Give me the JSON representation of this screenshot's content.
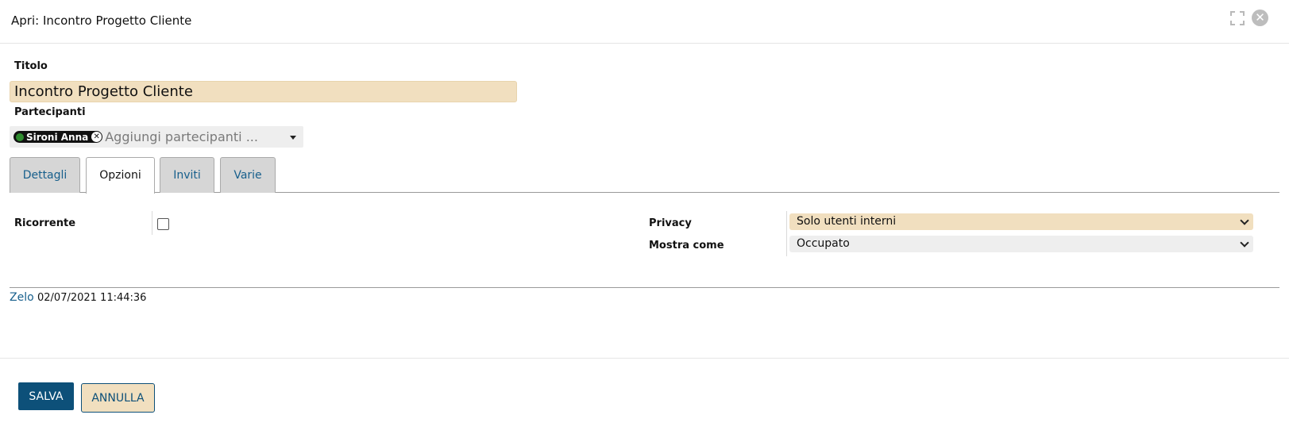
{
  "window": {
    "title": "Apri: Incontro Progetto Cliente",
    "maximize_icon": "maximize-icon",
    "close_icon": "close-icon",
    "close_glyph": "✕"
  },
  "form": {
    "title_label": "Titolo",
    "title_value": "Incontro Progetto Cliente",
    "participants_label": "Partecipanti",
    "participants": [
      {
        "name": "Sironi Anna",
        "status_color": "#2e8b2e"
      }
    ],
    "participants_placeholder": "Aggiungi partecipanti ...",
    "chip_remove_glyph": "✕"
  },
  "tabs": [
    {
      "label": "Dettagli",
      "active": false
    },
    {
      "label": "Opzioni",
      "active": true
    },
    {
      "label": "Inviti",
      "active": false
    },
    {
      "label": "Varie",
      "active": false
    }
  ],
  "options": {
    "recurring_label": "Ricorrente",
    "recurring_checked": false,
    "privacy_label": "Privacy",
    "privacy_value": "Solo utenti interni",
    "show_as_label": "Mostra come",
    "show_as_value": "Occupato"
  },
  "audit": {
    "user": "Zelo",
    "timestamp": "02/07/2021 11:44:36"
  },
  "actions": {
    "save_label": "SALVA",
    "cancel_label": "ANNULLA"
  },
  "colors": {
    "accent": "#0d5079",
    "highlight_field": "#f1dfbf",
    "link": "#175f8c"
  }
}
